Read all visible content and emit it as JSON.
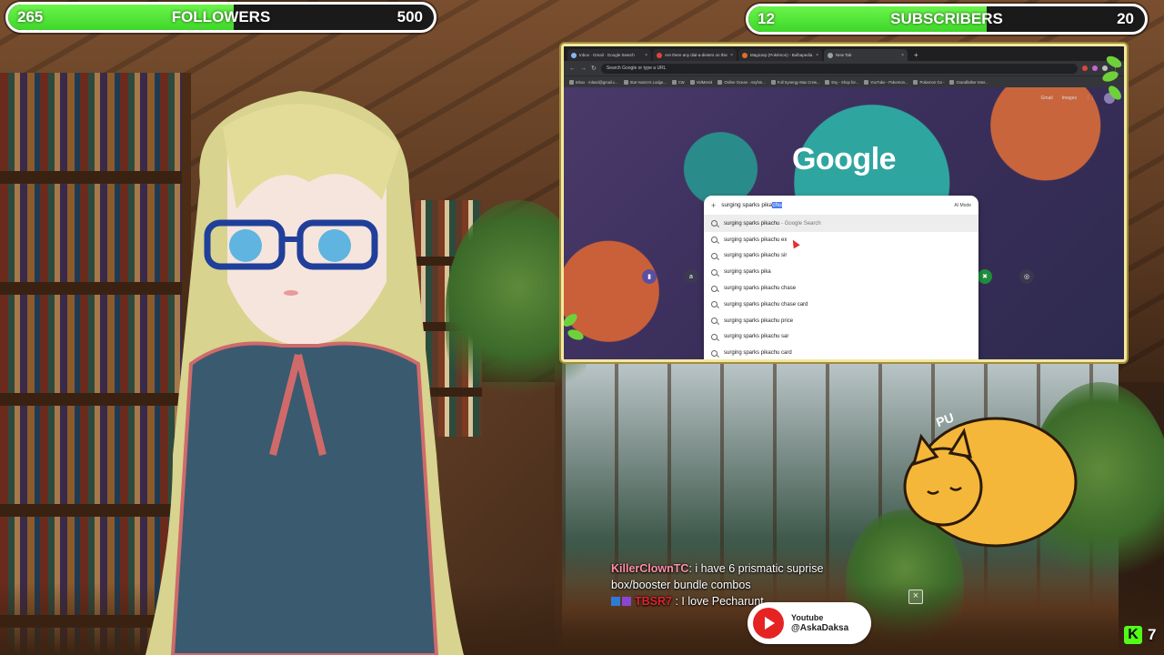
{
  "goals": {
    "followers": {
      "current": "265",
      "title": "FOLLOWERS",
      "target": "500",
      "progress": 0.53
    },
    "subscribers": {
      "current": "12",
      "title": "SUBSCRIBERS",
      "target": "20",
      "progress": 0.6
    }
  },
  "browser": {
    "tabs": [
      {
        "title": "Inbox · Gmail · Google Search"
      },
      {
        "title": "Are there any dial-a-dieters on this..."
      },
      {
        "title": "Magicarp (Pokémon) - Bulbapedia..."
      },
      {
        "title": "New Tab",
        "active": true
      }
    ],
    "omnibox_placeholder": "Search Google or type a URL",
    "bookmarks": [
      "Inbox · roland@gmail.c...",
      "Star Hanzo's Lodge...",
      "CW",
      "VidMetrol",
      "Online Ocean - Asyhm...",
      "Full Synergy Max Crew...",
      "Esy - Shop for...",
      "YouTube - Pokemon...",
      "Pokemon Go -",
      "Grandfather Inter..."
    ],
    "page_topright": [
      "Gmail",
      "Images"
    ],
    "logo": "Google",
    "search_query_typed": "surging sparks pika",
    "search_query_selected": "chu",
    "ai_mode_label": "AI Mode",
    "suggestions": [
      {
        "text": "surging sparks pikachu",
        "suffix": " - Google Search",
        "highlighted": true
      },
      {
        "text": "surging sparks pikachu ex",
        "suffix": ""
      },
      {
        "text": "surging sparks pikachu sir",
        "suffix": ""
      },
      {
        "text": "surging sparks pika",
        "suffix": ""
      },
      {
        "text": "surging sparks pikachu chase",
        "suffix": ""
      },
      {
        "text": "surging sparks pikachu chase card",
        "suffix": ""
      },
      {
        "text": "surging sparks pikachu price",
        "suffix": ""
      },
      {
        "text": "surging sparks pikachu sar",
        "suffix": ""
      },
      {
        "text": "surging sparks pikachu card",
        "suffix": ""
      }
    ]
  },
  "cat": {
    "sound": "PU"
  },
  "chat": [
    {
      "user": "KillerClownTC",
      "message": ": i have 6 prismatic suprise box/booster bundle combos"
    },
    {
      "user": "TBSR7",
      "message": ": I love Pecharunt"
    }
  ],
  "youtube": {
    "platform": "Youtube",
    "handle": "@AskaDaksa"
  },
  "kick": {
    "count": "7",
    "logo": "K"
  },
  "colors": {
    "bar_fill": "#3fd62a",
    "frame": "#f2e8a0",
    "youtube_red": "#e52323",
    "kick_green": "#53fc18"
  }
}
